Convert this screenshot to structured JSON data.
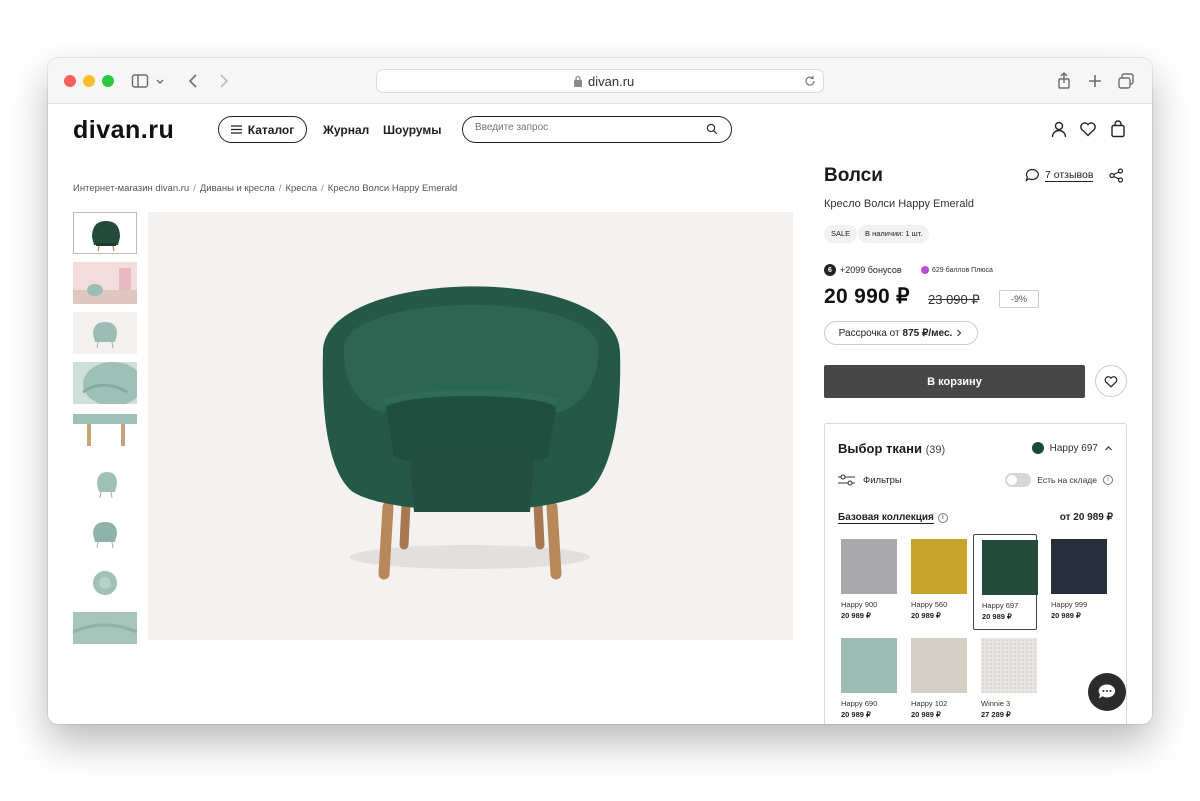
{
  "browser": {
    "url": "divan.ru"
  },
  "header": {
    "logo": "divan.ru",
    "catalog_label": "Каталог",
    "nav": [
      "Журнал",
      "Шоурумы"
    ],
    "search_placeholder": "Введите запрос"
  },
  "breadcrumb": [
    "Интернет-магазин divan.ru",
    "Диваны и кресла",
    "Кресла",
    "Кресло Волси Happy Emerald"
  ],
  "product": {
    "title": "Волси",
    "reviews": "7 отзывов",
    "subtitle": "Кресло Волси Happy Emerald",
    "badges": [
      "SALE",
      "В наличии: 1 шт."
    ],
    "bonus_badge": "6",
    "bonus_text": "+2099 бонусов",
    "plus_text": "629 баллов Плюса",
    "price": "20 990 ₽",
    "old_price": "23 090 ₽",
    "discount": "-9%",
    "installment_prefix": "Рассрочка от",
    "installment_amount": "875 ₽/мес.",
    "cart_label": "В корзину"
  },
  "fabric": {
    "title": "Выбор ткани",
    "count": "(39)",
    "current": "Happy 697",
    "filters_label": "Фильтры",
    "stock_label": "Есть на складе",
    "collection_label": "Базовая коллекция",
    "collection_price": "от 20 989 ₽",
    "swatches": [
      {
        "name": "Happy 900",
        "price": "20 989 ₽",
        "color": "#a9a9ac"
      },
      {
        "name": "Happy 560",
        "price": "20 989 ₽",
        "color": "#c9a42c"
      },
      {
        "name": "Happy 697",
        "price": "20 989 ₽",
        "color": "#254b3d"
      },
      {
        "name": "Happy 999",
        "price": "20 989 ₽",
        "color": "#27303a"
      },
      {
        "name": "Happy 690",
        "price": "20 989 ₽",
        "color": "#9dbcb3"
      },
      {
        "name": "Happy 102",
        "price": "20 989 ₽",
        "color": "#d3cfc5"
      },
      {
        "name": "Winnie 3",
        "price": "27 289 ₽",
        "color": "#e8e6e2"
      }
    ]
  }
}
